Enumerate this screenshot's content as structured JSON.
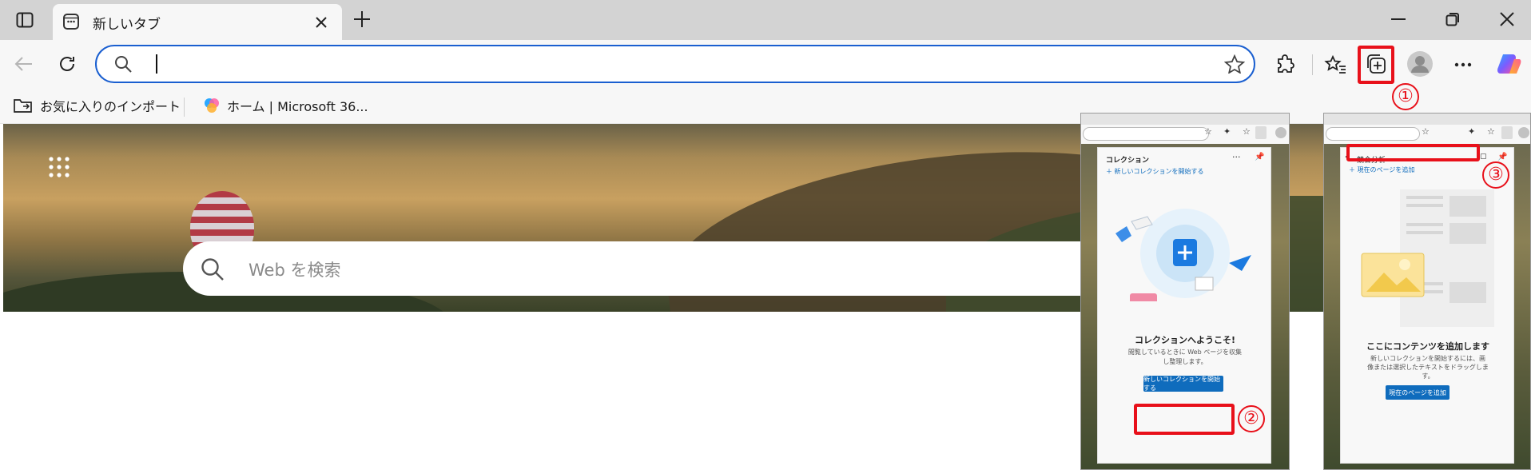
{
  "tab": {
    "title": "新しいタブ"
  },
  "favorites": [
    {
      "label": "お気に入りのインポート"
    },
    {
      "label": "ホーム | Microsoft 36..."
    }
  ],
  "address": {
    "value": ""
  },
  "newtab": {
    "search_placeholder": "Web を検索"
  },
  "callouts": [
    "①",
    "②",
    "③"
  ],
  "panel1": {
    "title": "コレクション",
    "start_link": "新しいコレクションを開始する",
    "welcome_title": "コレクションへようこそ!",
    "welcome_desc_1": "閲覧しているときに Web ページを収集",
    "welcome_desc_2": "し整理します。",
    "start_button": "新しいコレクションを開始する"
  },
  "panel2": {
    "name_input_value": "競合分析",
    "add_current_link": "現在のページを追加",
    "empty_title": "ここにコンテンツを追加します",
    "empty_desc_1": "新しいコレクションを開始するには、画",
    "empty_desc_2": "像または選択したテキストをドラッグしま",
    "empty_desc_3": "す。",
    "add_button": "現在のページを追加"
  },
  "colors": {
    "accent": "#1a5fd0",
    "callout_red": "#e8101a",
    "button_blue": "#0f6cbd"
  }
}
